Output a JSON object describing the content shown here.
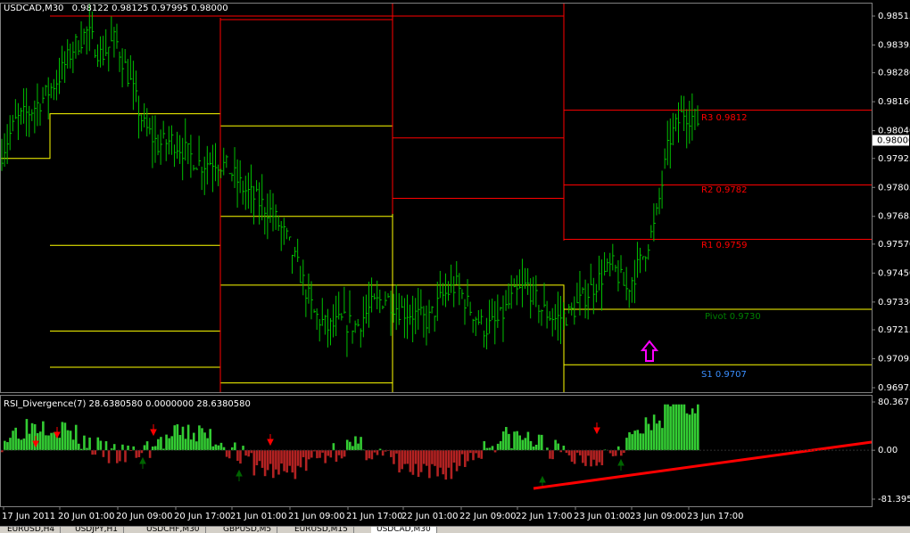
{
  "header": {
    "symbol": "USDCAD,M30",
    "ohlc": "0.98122 0.98125 0.97995 0.98000"
  },
  "indicator": {
    "title": "RSI_Divergence(7) 28.6380580 0.0000000 28.6380580"
  },
  "price_axis": [
    "0.98515",
    "0.98395",
    "0.98280",
    "0.98160",
    "0.98040",
    "0.97925",
    "0.97805",
    "0.97685",
    "0.97570",
    "0.97450",
    "0.97330",
    "0.97215",
    "0.97095",
    "0.96975"
  ],
  "current_price": "0.98000",
  "indicator_axis": [
    "80.36710",
    "0.00",
    "-81.39566"
  ],
  "time_axis": [
    "17 Jun 2011",
    "20 Jun 01:00",
    "20 Jun 09:00",
    "20 Jun 17:00",
    "21 Jun 01:00",
    "21 Jun 09:00",
    "21 Jun 17:00",
    "22 Jun 01:00",
    "22 Jun 09:00",
    "22 Jun 17:00",
    "23 Jun 01:00",
    "23 Jun 09:00",
    "23 Jun 17:00"
  ],
  "pivot_labels": {
    "r3": "R3 0.9812",
    "r2": "R2 0.9782",
    "r1": "R1 0.9759",
    "pivot": "Pivot 0.9730",
    "s1": "S1 0.9707"
  },
  "tabs": [
    "EURUSD,H4",
    "USDJPY,H1",
    "USDCHF,M30",
    "GBPUSD,M5",
    "EURUSD,M15",
    "USDCAD,M30"
  ],
  "colors": {
    "candle": "#00c000",
    "resistance": "#ff0000",
    "support": "#ffff00",
    "pivot_level": "#ffff00",
    "pivot_label": "#008000",
    "s1_label": "#3a8fff",
    "hist_pos": "#33cc33",
    "hist_neg": "#b22222",
    "arrow_up": "#006400",
    "arrow_down": "#ff0000",
    "marker": "#ff00ff"
  },
  "chart_data": [
    {
      "type": "ohlc",
      "title": "USDCAD,M30",
      "ylim": [
        0.96975,
        0.98515
      ],
      "x_categories": [
        "17 Jun 2011",
        "20 Jun 01:00",
        "20 Jun 09:00",
        "20 Jun 17:00",
        "21 Jun 01:00",
        "21 Jun 09:00",
        "21 Jun 17:00",
        "22 Jun 01:00",
        "22 Jun 09:00",
        "22 Jun 17:00",
        "23 Jun 01:00",
        "23 Jun 09:00",
        "23 Jun 17:00"
      ],
      "close_path": [
        0.9795,
        0.9808,
        0.9812,
        0.9818,
        0.9826,
        0.9838,
        0.9845,
        0.9835,
        0.9842,
        0.9825,
        0.9806,
        0.9798,
        0.98,
        0.9795,
        0.979,
        0.9792,
        0.9788,
        0.978,
        0.9775,
        0.977,
        0.976,
        0.9745,
        0.9728,
        0.9722,
        0.9725,
        0.9723,
        0.9731,
        0.9735,
        0.973,
        0.9728,
        0.9725,
        0.9735,
        0.974,
        0.973,
        0.9722,
        0.9725,
        0.9735,
        0.974,
        0.973,
        0.9726,
        0.9728,
        0.9735,
        0.9742,
        0.9748,
        0.9738,
        0.975,
        0.9765,
        0.98,
        0.9812,
        0.9808
      ],
      "daily_pivots": [
        {
          "day": "20 Jun",
          "R3": 0.985,
          "R1": 0.981,
          "P": 0.9752,
          "S1": 0.9721
        },
        {
          "day": "21 Jun",
          "R3": 0.9861,
          "R1": 0.981,
          "P": 0.9768,
          "S1": 0.974,
          "S2": 0.9692
        },
        {
          "day": "22 Jun",
          "R3": 0.985,
          "R1": 0.9768,
          "P": 0.974
        },
        {
          "day": "23 Jun",
          "R3": 0.9812,
          "R2": 0.9782,
          "R1": 0.9759,
          "P": 0.973,
          "S1": 0.9707
        }
      ]
    },
    {
      "type": "bar",
      "title": "RSI_Divergence(7)",
      "ylim": [
        -81.39566,
        80.3671
      ],
      "current_value": 28.638058,
      "divergence_line": "rising support from ~23 Jun 01:00 (-70) to chart end (10)"
    }
  ]
}
